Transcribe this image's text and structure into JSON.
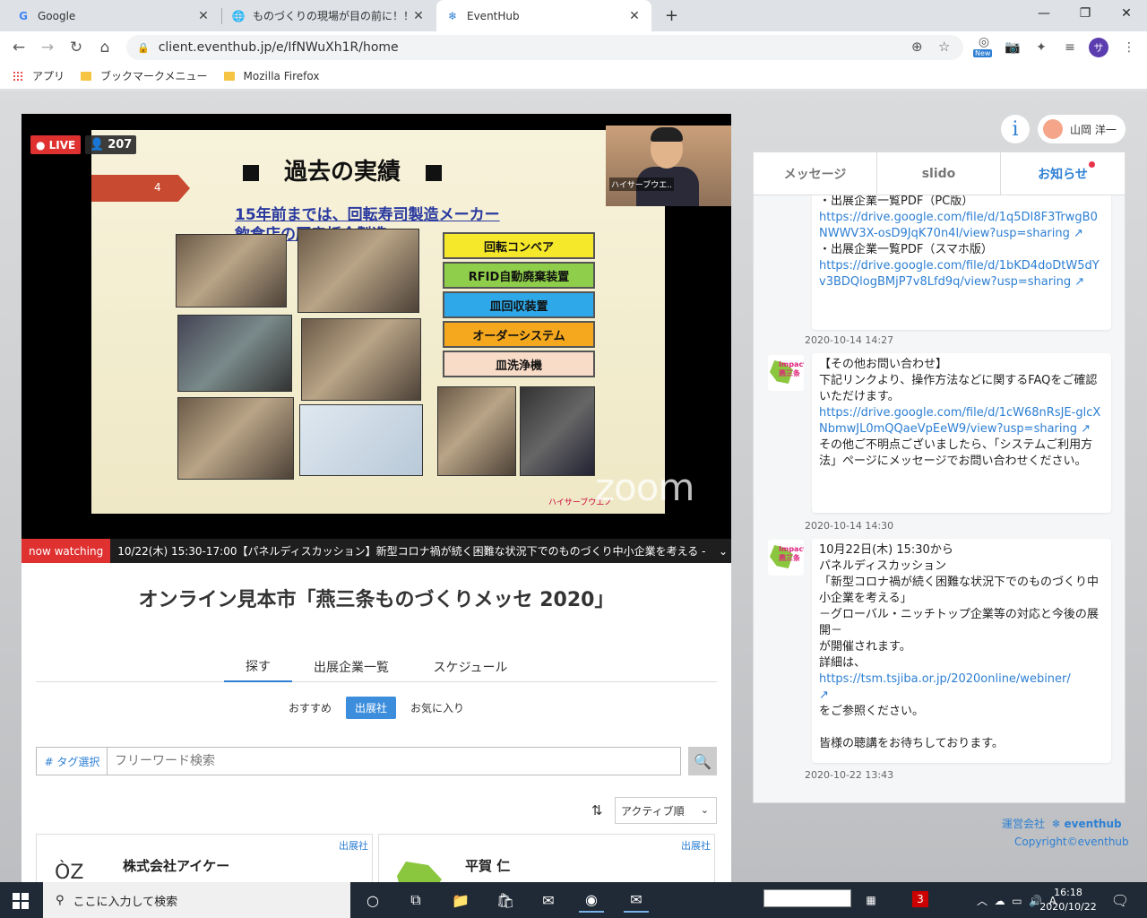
{
  "browser": {
    "tabs": [
      {
        "title": "Google",
        "icon": "G"
      },
      {
        "title": "ものづくりの現場が目の前に！！新",
        "icon": "globe-icon"
      },
      {
        "title": "EventHub",
        "icon": "eventhub-icon"
      }
    ],
    "url": "client.eventhub.jp/e/IfNWuXh1R/home",
    "ext_new_badge": "New",
    "profile_initial": "サ",
    "bookmarks": [
      "アプリ",
      "ブックマークメニュー",
      "Mozilla Firefox"
    ]
  },
  "video": {
    "live_label": "LIVE",
    "viewer_count": "207",
    "slide": {
      "number": "4",
      "title": "過去の実績",
      "subtitle_line1": "15年前までは、回転寿司製造メーカー",
      "subtitle_line2": "飲食店の厨房板金製造",
      "boxes": [
        {
          "label": "回転コンベア",
          "color": "#f5e82a"
        },
        {
          "label": "RFID自動廃棄装置",
          "color": "#8fce4a"
        },
        {
          "label": "皿回収装置",
          "color": "#2ea8e8"
        },
        {
          "label": "オーダーシステム",
          "color": "#f5a81e"
        },
        {
          "label": "皿洗浄機",
          "color": "#f9dcc8"
        }
      ],
      "brand": "ハイサーブウエノ"
    },
    "camera_name": "ハイサーブウエ..",
    "zoom_watermark": "zoom"
  },
  "now_watching": {
    "tag": "now watching",
    "text": "10/22(木) 15:30-17:00【パネルディスカッション】新型コロナ禍が続く困難な状況下でのものづくり中小企業を考える -"
  },
  "event_title": "オンライン見本市「燕三条ものづくりメッセ 2020」",
  "main_tabs": [
    "探す",
    "出展企業一覧",
    "スケジュール"
  ],
  "sub_tabs": [
    "おすすめ",
    "出展社",
    "お気に入り"
  ],
  "search": {
    "tag_button": "# タグ選択",
    "placeholder": "フリーワード検索"
  },
  "sort": {
    "selected": "アクティブ順"
  },
  "cards": [
    {
      "badge": "出展社",
      "name": "株式会社アイケー"
    },
    {
      "badge": "出展社",
      "name": "平賀 仁"
    }
  ],
  "header_user": {
    "name": "山岡 洋一"
  },
  "panel_tabs": [
    "メッセージ",
    "slido",
    "お知らせ"
  ],
  "notices": {
    "first": {
      "line1": "・出展企業一覧PDF（PC版）",
      "link1": "https://drive.google.com/file/d/1q5DI8F3TrwgB0NWWV3X-osD9JqK70n4l/view?usp=sharing",
      "line2": "・出展企業一覧PDF（スマホ版）",
      "link2": "https://drive.google.com/file/d/1bKD4doDtW5dYv3BDQlogBMjP7v8Lfd9q/view?usp=sharing",
      "time": "2020-10-14 14:27"
    },
    "second": {
      "line1": "【その他お問い合わせ】",
      "line2": "下記リンクより、操作方法などに関するFAQをご確認いただけます。",
      "link": "https://drive.google.com/file/d/1cW68nRsJE-glcXNbmwJL0mQQaeVpEeW9/view?usp=sharing",
      "line3": "その他ご不明点ございましたら、「システムご利用方法」ページにメッセージでお問い合わせください。",
      "time": "2020-10-14 14:30"
    },
    "third": {
      "line1": "10月22日(木) 15:30から",
      "line2": "パネルディスカッション",
      "line3": "「新型コロナ禍が続く困難な状況下でのものづくり中小企業を考える」",
      "line4": "－グローバル・ニッチトップ企業等の対応と今後の展開－",
      "line5": "が開催されます。",
      "line6": "詳細は、",
      "link": "https://tsm.tsjiba.or.jp/2020online/webiner/",
      "line7": "をご参照ください。",
      "line8": "皆様の聴講をお待ちしております。",
      "time": "2020-10-22 13:43"
    },
    "logo_text": "Impact! 燕三条"
  },
  "footer": {
    "company_label": "運営会社",
    "brand": "eventhub",
    "copyright": "Copyright©eventhub"
  },
  "taskbar": {
    "search_placeholder": "ここに入力して検索",
    "time": "16:18",
    "date": "2020/10/22"
  }
}
